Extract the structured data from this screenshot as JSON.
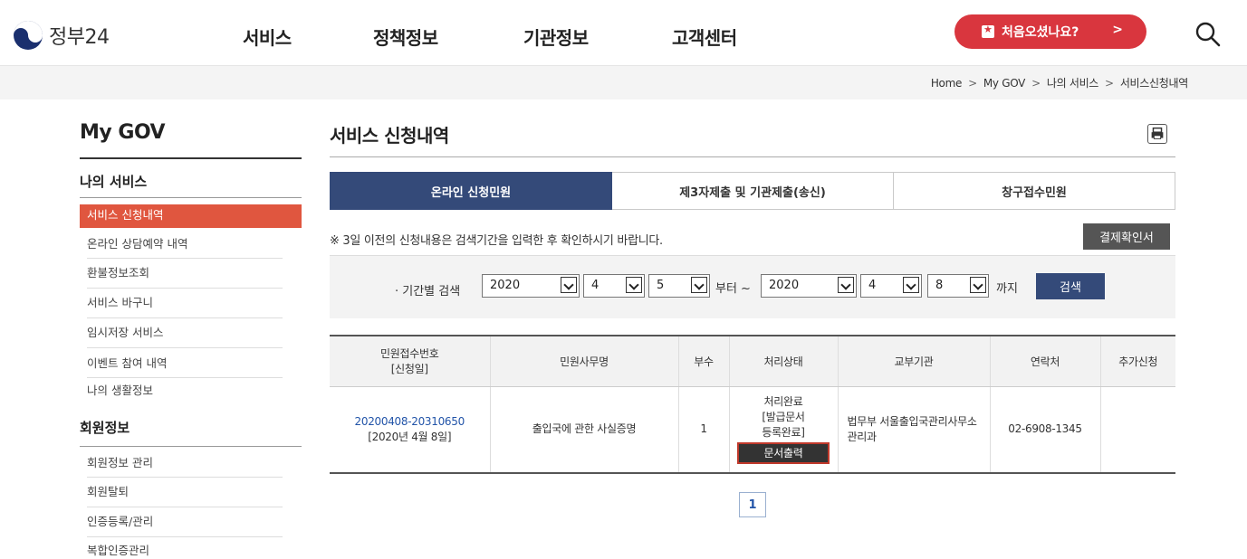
{
  "header": {
    "logo_text": "정부24",
    "nav": [
      "서비스",
      "정책정보",
      "기관정보",
      "고객센터"
    ],
    "first_visit_label": "처음오셨나요?",
    "first_visit_chevron": ">",
    "accent": "#d9363e"
  },
  "breadcrumb": [
    "Home",
    "My GOV",
    "나의 서비스",
    "서비스신청내역"
  ],
  "sidebar": {
    "title": "My GOV",
    "section_my_service": "나의 서비스",
    "my_service_items": [
      "서비스 신청내역",
      "온라인 상담예약 내역",
      "환불정보조회",
      "서비스 바구니",
      "임시저장 서비스",
      "이벤트 참여 내역",
      "나의 생활정보"
    ],
    "section_member": "회원정보",
    "member_items": [
      "회원정보 관리",
      "회원탈퇴",
      "인증등록/관리",
      "복합인증관리"
    ],
    "active_color": "#e0563f"
  },
  "main": {
    "title": "서비스 신청내역",
    "tabs": [
      "온라인 신청민원",
      "제3자제출 및 기관제출(송신)",
      "창구접수민원"
    ],
    "active_tab_color": "#344a79",
    "notice": "※ 3일 이전의 신청내용은 검색기간을 입력한 후 확인하시기 바랍니다.",
    "receipt_button": "결제확인서",
    "search": {
      "label": "· 기간별 검색",
      "from_year": "2020",
      "from_month": "4",
      "from_day": "5",
      "from_text": "부터 ~",
      "to_year": "2020",
      "to_month": "4",
      "to_day": "8",
      "to_text": "까지",
      "button": "검색"
    },
    "table": {
      "headers": [
        "민원접수번호",
        "[신청일]",
        "민원사무명",
        "부수",
        "처리상태",
        "교부기관",
        "연락처",
        "추가신청"
      ],
      "row": {
        "receipt_no": "20200408-20310650",
        "apply_date": "[2020년 4월 8일]",
        "service_name": "출입국에 관한 사실증명",
        "copies": "1",
        "status_1": "처리완료",
        "status_2": "[발급문서",
        "status_3": "등록완료]",
        "print_button": "문서출력",
        "agency": "법무부 서울출입국관리사무소 관리과",
        "contact": "02-6908-1345",
        "extra": ""
      }
    },
    "page": "1"
  }
}
